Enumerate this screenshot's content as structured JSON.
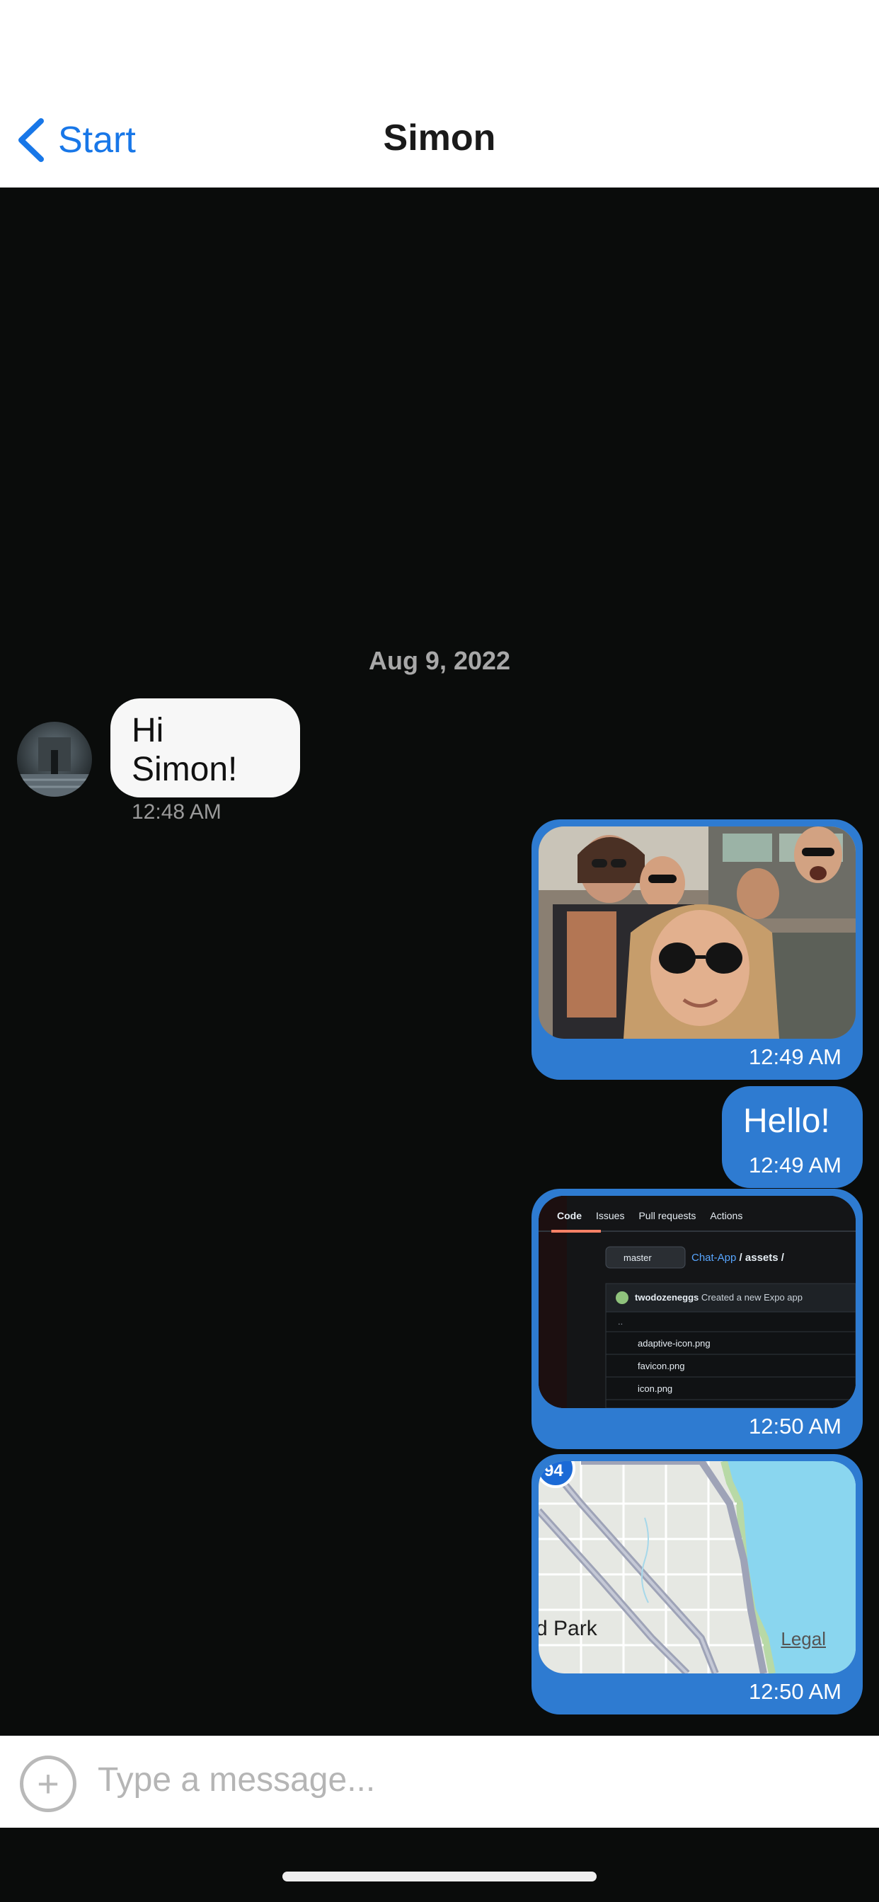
{
  "header": {
    "back_label": "Start",
    "title": "Simon"
  },
  "chat": {
    "date_separator": "Aug 9, 2022",
    "messages": [
      {
        "direction": "incoming",
        "text": "Hi Simon!",
        "time": "12:48 AM"
      },
      {
        "direction": "outgoing",
        "type": "image",
        "time": "12:49 AM"
      },
      {
        "direction": "outgoing",
        "text": "Hello!",
        "time": "12:49 AM"
      },
      {
        "direction": "outgoing",
        "type": "image",
        "time": "12:50 AM"
      },
      {
        "direction": "outgoing",
        "type": "map",
        "time": "12:50 AM"
      }
    ],
    "github_screenshot": {
      "tabs": [
        "Code",
        "Issues",
        "Pull requests",
        "Actions"
      ],
      "branch": "master",
      "path_repo": "Chat-App",
      "path_rest": "/ assets /",
      "commit_user": "twodozeneggs",
      "commit_msg": "Created a new Expo app",
      "parent_dir": "..",
      "files": [
        "adaptive-icon.png",
        "favicon.png",
        "icon.png"
      ]
    },
    "map": {
      "route_badge": "94",
      "place_label": "d Park",
      "legal": "Legal"
    }
  },
  "composer": {
    "placeholder": "Type a message...",
    "plus_symbol": "+"
  },
  "colors": {
    "accent": "#1877e8",
    "outgoing_bubble": "#2e7bd1",
    "incoming_bubble": "#f7f7f7",
    "chat_background": "#0a0c0b"
  }
}
